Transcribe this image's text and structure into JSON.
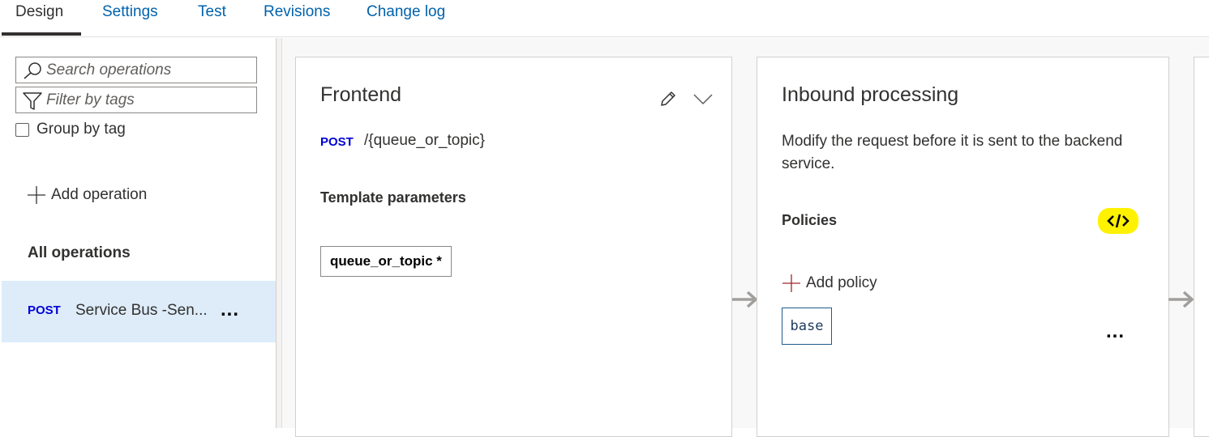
{
  "tabs": [
    {
      "label": "Design"
    },
    {
      "label": "Settings"
    },
    {
      "label": "Test"
    },
    {
      "label": "Revisions"
    },
    {
      "label": "Change log"
    }
  ],
  "sidebar": {
    "search_placeholder": "Search operations",
    "filter_placeholder": "Filter by tags",
    "group_by_tag_label": "Group by tag",
    "group_by_tag_checked": false,
    "add_operation_label": "Add operation",
    "all_operations_label": "All operations",
    "operations": [
      {
        "method": "POST",
        "name": "Service Bus -Sen...",
        "more": "..."
      }
    ]
  },
  "frontend": {
    "title": "Frontend",
    "method": "POST",
    "path": "/{queue_or_topic}",
    "template_parameters_label": "Template parameters",
    "parameter": "queue_or_topic *"
  },
  "inbound": {
    "title": "Inbound processing",
    "description": "Modify the request before it is sent to the backend service.",
    "policies_label": "Policies",
    "code_editor_icon": "code-icon",
    "code_highlight_color": "#fff200",
    "add_policy_label": "Add policy",
    "base_label": "base",
    "more": "..."
  },
  "colors": {
    "accent": "#0062ad",
    "method_post": "#0000d8",
    "selected_row": "#deecf9"
  }
}
